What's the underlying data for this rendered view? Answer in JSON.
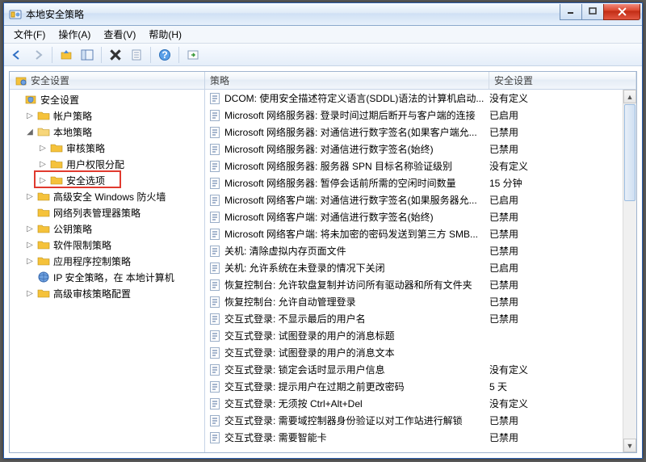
{
  "window": {
    "title": "本地安全策略"
  },
  "menu": {
    "file": "文件(F)",
    "action": "操作(A)",
    "view": "查看(V)",
    "help": "帮助(H)"
  },
  "tree_header": "安全设置",
  "list_headers": {
    "policy": "策略",
    "setting": "安全设置"
  },
  "tree": [
    {
      "label": "安全设置",
      "indent": 0,
      "expander": "none",
      "icon": "root"
    },
    {
      "label": "帐户策略",
      "indent": 1,
      "expander": "closed",
      "icon": "folder"
    },
    {
      "label": "本地策略",
      "indent": 1,
      "expander": "open",
      "icon": "folder-open"
    },
    {
      "label": "审核策略",
      "indent": 2,
      "expander": "closed",
      "icon": "folder"
    },
    {
      "label": "用户权限分配",
      "indent": 2,
      "expander": "closed",
      "icon": "folder"
    },
    {
      "label": "安全选项",
      "indent": 2,
      "expander": "closed",
      "icon": "folder",
      "highlighted": true
    },
    {
      "label": "高级安全 Windows 防火墙",
      "indent": 1,
      "expander": "closed",
      "icon": "folder"
    },
    {
      "label": "网络列表管理器策略",
      "indent": 1,
      "expander": "none",
      "icon": "folder"
    },
    {
      "label": "公钥策略",
      "indent": 1,
      "expander": "closed",
      "icon": "folder"
    },
    {
      "label": "软件限制策略",
      "indent": 1,
      "expander": "closed",
      "icon": "folder"
    },
    {
      "label": "应用程序控制策略",
      "indent": 1,
      "expander": "closed",
      "icon": "folder"
    },
    {
      "label": "IP 安全策略，在 本地计算机",
      "indent": 1,
      "expander": "none",
      "icon": "ipsec"
    },
    {
      "label": "高级审核策略配置",
      "indent": 1,
      "expander": "closed",
      "icon": "folder"
    }
  ],
  "policies": [
    {
      "policy": "DCOM: 使用安全描述符定义语言(SDDL)语法的计算机启动...",
      "setting": "没有定义"
    },
    {
      "policy": "Microsoft 网络服务器: 登录时间过期后断开与客户端的连接",
      "setting": "已启用"
    },
    {
      "policy": "Microsoft 网络服务器: 对通信进行数字签名(如果客户端允...",
      "setting": "已禁用"
    },
    {
      "policy": "Microsoft 网络服务器: 对通信进行数字签名(始终)",
      "setting": "已禁用"
    },
    {
      "policy": "Microsoft 网络服务器: 服务器 SPN 目标名称验证级别",
      "setting": "没有定义"
    },
    {
      "policy": "Microsoft 网络服务器: 暂停会话前所需的空闲时间数量",
      "setting": "15 分钟"
    },
    {
      "policy": "Microsoft 网络客户端: 对通信进行数字签名(如果服务器允...",
      "setting": "已启用"
    },
    {
      "policy": "Microsoft 网络客户端: 对通信进行数字签名(始终)",
      "setting": "已禁用"
    },
    {
      "policy": "Microsoft 网络客户端: 将未加密的密码发送到第三方 SMB...",
      "setting": "已禁用"
    },
    {
      "policy": "关机: 清除虚拟内存页面文件",
      "setting": "已禁用"
    },
    {
      "policy": "关机: 允许系统在未登录的情况下关闭",
      "setting": "已启用"
    },
    {
      "policy": "恢复控制台: 允许软盘复制并访问所有驱动器和所有文件夹",
      "setting": "已禁用"
    },
    {
      "policy": "恢复控制台: 允许自动管理登录",
      "setting": "已禁用"
    },
    {
      "policy": "交互式登录: 不显示最后的用户名",
      "setting": "已禁用"
    },
    {
      "policy": "交互式登录: 试图登录的用户的消息标题",
      "setting": ""
    },
    {
      "policy": "交互式登录: 试图登录的用户的消息文本",
      "setting": ""
    },
    {
      "policy": "交互式登录: 锁定会话时显示用户信息",
      "setting": "没有定义"
    },
    {
      "policy": "交互式登录: 提示用户在过期之前更改密码",
      "setting": "5 天"
    },
    {
      "policy": "交互式登录: 无须按 Ctrl+Alt+Del",
      "setting": "没有定义"
    },
    {
      "policy": "交互式登录: 需要域控制器身份验证以对工作站进行解锁",
      "setting": "已禁用"
    },
    {
      "policy": "交互式登录: 需要智能卡",
      "setting": "已禁用"
    }
  ]
}
